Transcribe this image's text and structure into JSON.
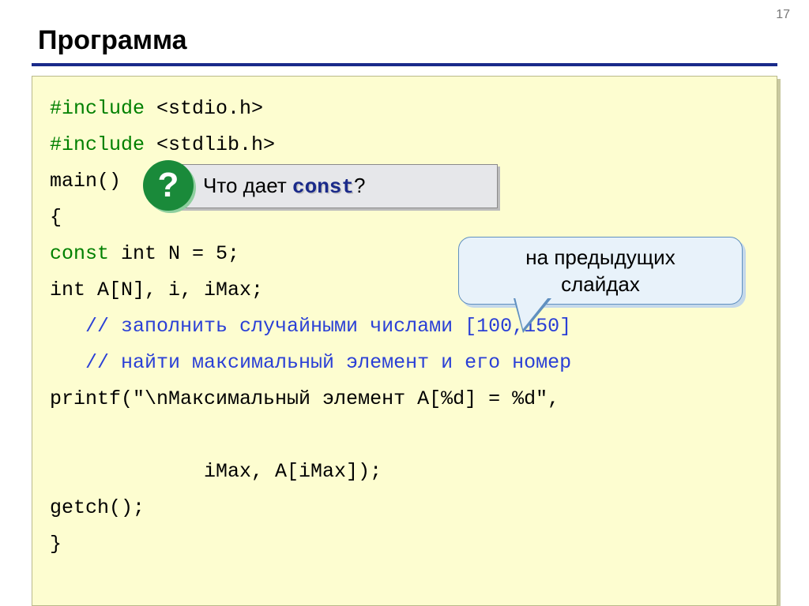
{
  "page_number": "17",
  "title": "Программа",
  "code": {
    "l1a": "#include",
    "l1b": " <stdio.h>",
    "l2a": "#include",
    "l2b": " <stdlib.h>",
    "l3": "main()",
    "l4": "{",
    "l5a": "const",
    "l5b": " int N = 5;",
    "l6": "int A[N], i, iMax;",
    "l7": "   // заполнить случайными числами [100,150]",
    "l8": "   // найти максимальный элемент и его номер",
    "l9": "printf(\"\\nМаксимальный элемент A[%d] = %d\",",
    "l10": "             iMax, A[iMax]);",
    "l11": "getch();",
    "l12": "}"
  },
  "question": {
    "badge": "?",
    "prefix": "Что дает ",
    "const_word": "const",
    "suffix": "?"
  },
  "speech": {
    "line1": "на предыдущих",
    "line2": "слайдах"
  }
}
